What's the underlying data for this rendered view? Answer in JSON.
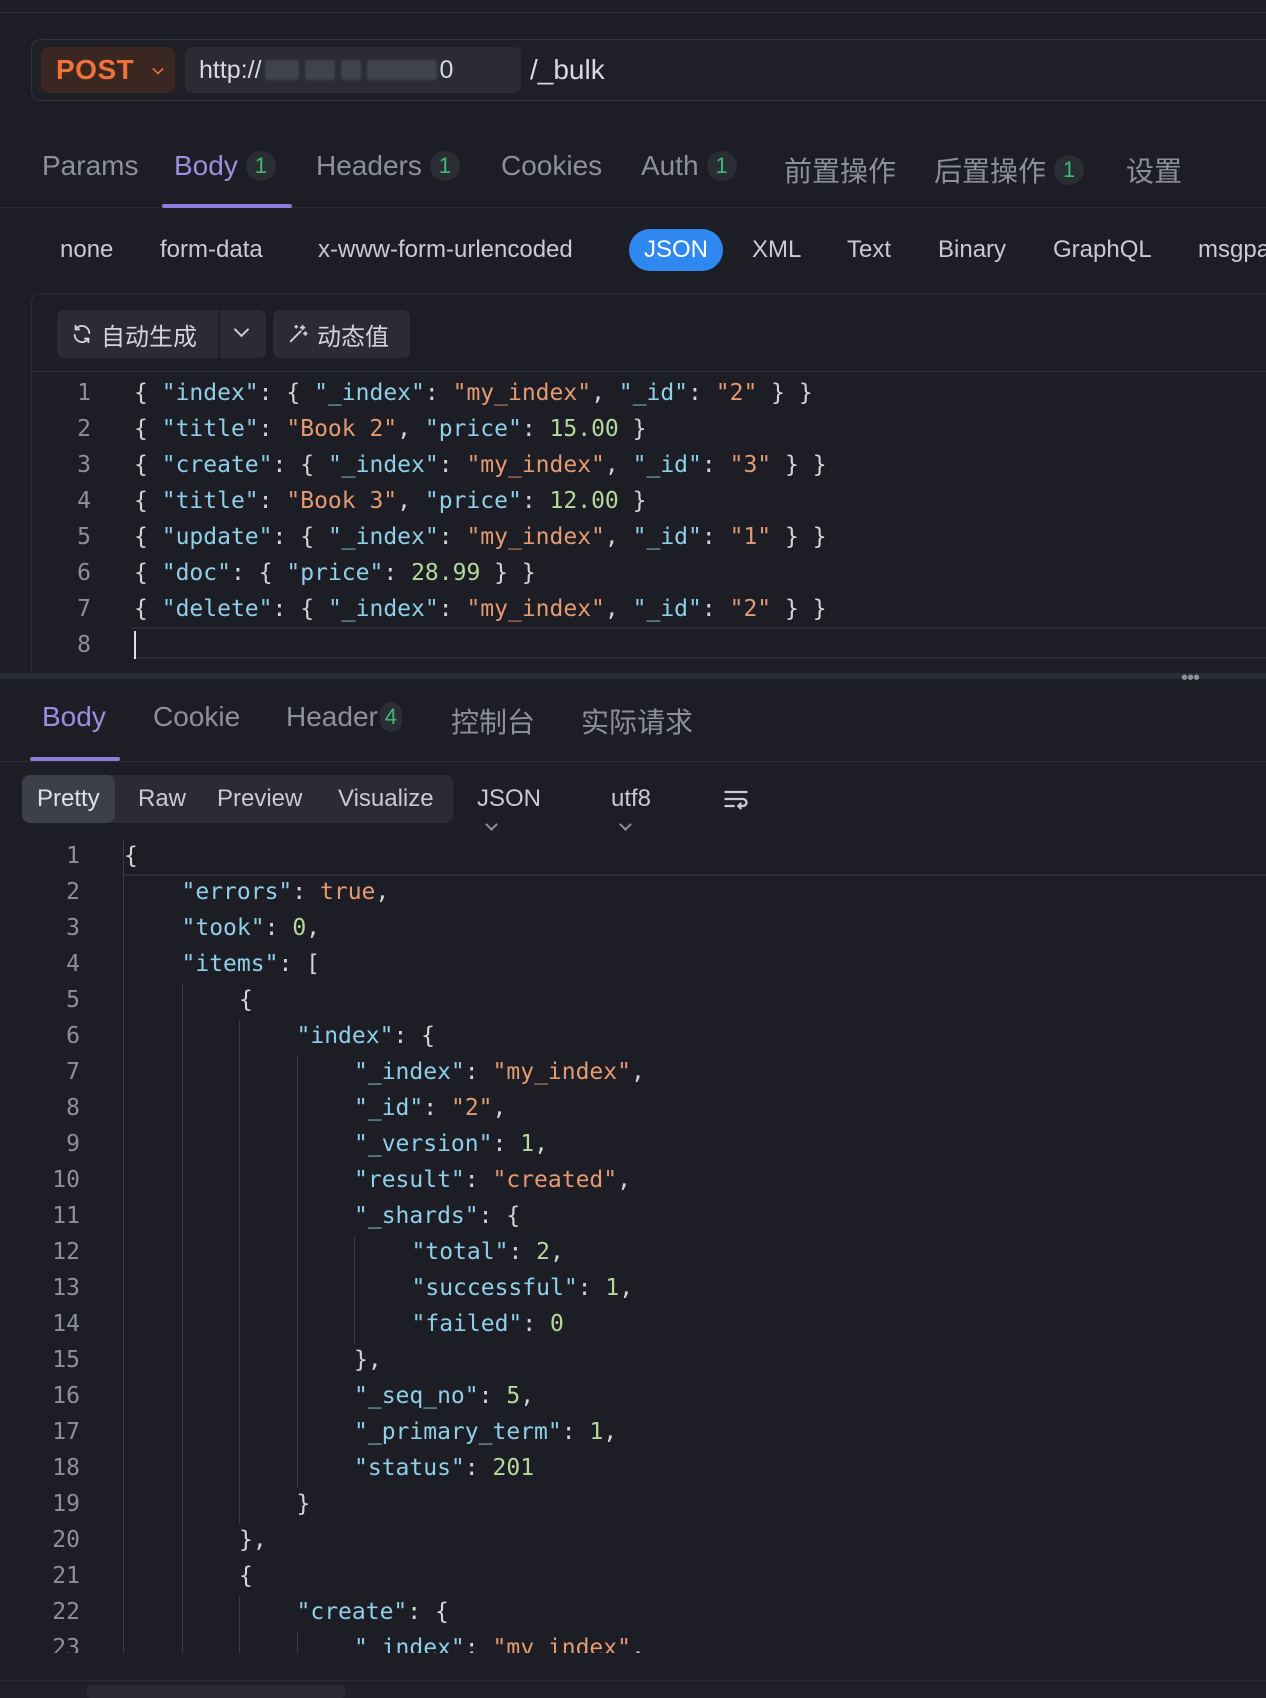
{
  "request": {
    "method": "POST",
    "url_prefix": "http://",
    "url_suffix": "0",
    "path": "/_bulk"
  },
  "request_tabs": [
    {
      "label": "Params",
      "badge": null,
      "active": false
    },
    {
      "label": "Body",
      "badge": "1",
      "active": true
    },
    {
      "label": "Headers",
      "badge": "1",
      "active": false
    },
    {
      "label": "Cookies",
      "badge": null,
      "active": false
    },
    {
      "label": "Auth",
      "badge": "1",
      "active": false
    },
    {
      "label": "前置操作",
      "badge": null,
      "active": false
    },
    {
      "label": "后置操作",
      "badge": "1",
      "active": false
    },
    {
      "label": "设置",
      "badge": null,
      "active": false
    }
  ],
  "body_types": [
    "none",
    "form-data",
    "x-www-form-urlencoded",
    "JSON",
    "XML",
    "Text",
    "Binary",
    "GraphQL",
    "msgpack"
  ],
  "body_type_active": "JSON",
  "editor_toolbar": {
    "auto_generate": "自动生成",
    "dynamic_value": "动态值"
  },
  "request_body_lines": [
    "{ \"index\": { \"_index\": \"my_index\", \"_id\": \"2\" } }",
    "{ \"title\": \"Book 2\", \"price\": 15.00 }",
    "{ \"create\": { \"_index\": \"my_index\", \"_id\": \"3\" } }",
    "{ \"title\": \"Book 3\", \"price\": 12.00 }",
    "{ \"update\": { \"_index\": \"my_index\", \"_id\": \"1\" } }",
    "{ \"doc\": { \"price\": 28.99 } }",
    "{ \"delete\": { \"_index\": \"my_index\", \"_id\": \"2\" } }",
    ""
  ],
  "response_tabs": [
    {
      "label": "Body",
      "badge": null,
      "active": true
    },
    {
      "label": "Cookie",
      "badge": null,
      "active": false
    },
    {
      "label": "Header",
      "badge": "4",
      "active": false
    },
    {
      "label": "控制台",
      "badge": null,
      "active": false
    },
    {
      "label": "实际请求",
      "badge": null,
      "active": false
    }
  ],
  "response_view_modes": [
    "Pretty",
    "Raw",
    "Preview",
    "Visualize"
  ],
  "response_view_active": "Pretty",
  "response_format": "JSON",
  "response_encoding": "utf8",
  "response_lines": [
    {
      "indent": 0,
      "text": "{"
    },
    {
      "indent": 1,
      "text": "\"errors\": true,"
    },
    {
      "indent": 1,
      "text": "\"took\": 0,"
    },
    {
      "indent": 1,
      "text": "\"items\": ["
    },
    {
      "indent": 2,
      "text": "{"
    },
    {
      "indent": 3,
      "text": "\"index\": {"
    },
    {
      "indent": 4,
      "text": "\"_index\": \"my_index\","
    },
    {
      "indent": 4,
      "text": "\"_id\": \"2\","
    },
    {
      "indent": 4,
      "text": "\"_version\": 1,"
    },
    {
      "indent": 4,
      "text": "\"result\": \"created\","
    },
    {
      "indent": 4,
      "text": "\"_shards\": {"
    },
    {
      "indent": 5,
      "text": "\"total\": 2,"
    },
    {
      "indent": 5,
      "text": "\"successful\": 1,"
    },
    {
      "indent": 5,
      "text": "\"failed\": 0"
    },
    {
      "indent": 4,
      "text": "},"
    },
    {
      "indent": 4,
      "text": "\"_seq_no\": 5,"
    },
    {
      "indent": 4,
      "text": "\"_primary_term\": 1,"
    },
    {
      "indent": 4,
      "text": "\"status\": 201"
    },
    {
      "indent": 3,
      "text": "}"
    },
    {
      "indent": 2,
      "text": "},"
    },
    {
      "indent": 2,
      "text": "{"
    },
    {
      "indent": 3,
      "text": "\"create\": {"
    },
    {
      "indent": 4,
      "text": "\"_index\": \"my_index\","
    }
  ],
  "colors": {
    "accent": "#8b7ddb",
    "method": "#f0713b",
    "json_active": "#2f88f0",
    "badge": "#3dbb74",
    "key": "#8fcfe8",
    "string": "#e69a72",
    "number": "#b7d89b"
  }
}
